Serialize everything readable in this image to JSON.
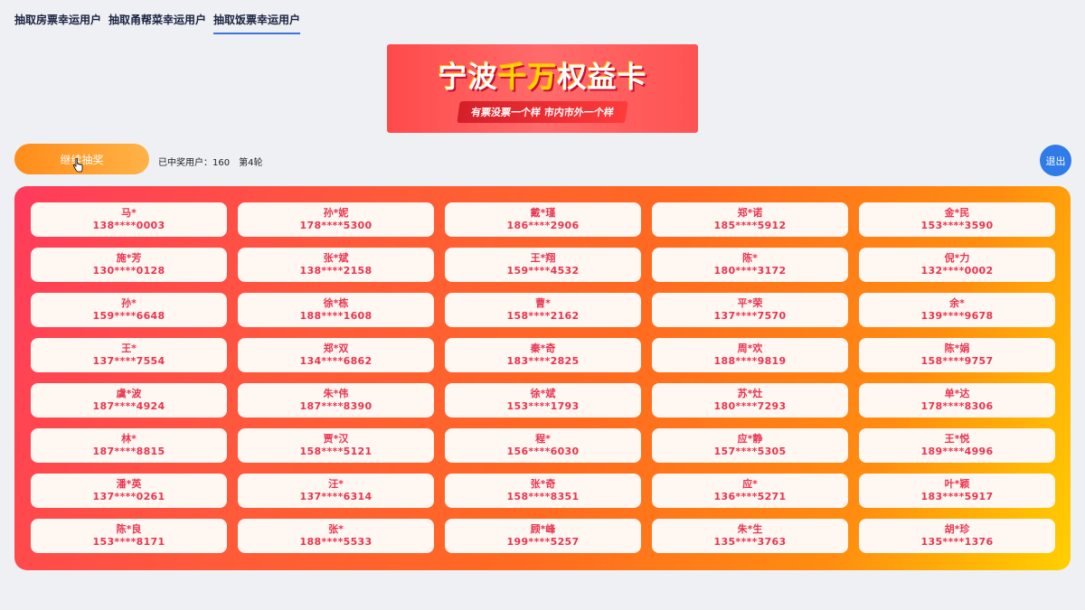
{
  "tabs": [
    {
      "label": "抽取房票幸运用户"
    },
    {
      "label": "抽取甬帮菜幸运用户"
    },
    {
      "label": "抽取饭票幸运用户"
    }
  ],
  "banner": {
    "title_prefix": "宁波",
    "title_highlight": "千万",
    "title_suffix": "权益卡",
    "subtitle": "有票没票一个样 市内市外一个样"
  },
  "toolbar": {
    "draw_label": "继续抽奖",
    "winners_text": "已中奖用户：160",
    "round_text": "第4轮",
    "exit_label": "退出"
  },
  "winners": [
    {
      "name": "马*",
      "phone": "138****0003"
    },
    {
      "name": "孙*妮",
      "phone": "178****5300"
    },
    {
      "name": "戴*瑾",
      "phone": "186****2906"
    },
    {
      "name": "郑*诺",
      "phone": "185****5912"
    },
    {
      "name": "金*民",
      "phone": "153****3590"
    },
    {
      "name": "施*芳",
      "phone": "130****0128"
    },
    {
      "name": "张*斌",
      "phone": "138****2158"
    },
    {
      "name": "王*翔",
      "phone": "159****4532"
    },
    {
      "name": "陈*",
      "phone": "180****3172"
    },
    {
      "name": "倪*力",
      "phone": "132****0002"
    },
    {
      "name": "孙*",
      "phone": "159****6648"
    },
    {
      "name": "徐*栋",
      "phone": "188****1608"
    },
    {
      "name": "曹*",
      "phone": "158****2162"
    },
    {
      "name": "平*荣",
      "phone": "137****7570"
    },
    {
      "name": "余*",
      "phone": "139****9678"
    },
    {
      "name": "王*",
      "phone": "137****7554"
    },
    {
      "name": "郑*双",
      "phone": "134****6862"
    },
    {
      "name": "秦*奇",
      "phone": "183****2825"
    },
    {
      "name": "周*欢",
      "phone": "188****9819"
    },
    {
      "name": "陈*娟",
      "phone": "158****9757"
    },
    {
      "name": "虞*波",
      "phone": "187****4924"
    },
    {
      "name": "朱*伟",
      "phone": "187****8390"
    },
    {
      "name": "徐*斌",
      "phone": "153****1793"
    },
    {
      "name": "苏*灶",
      "phone": "180****7293"
    },
    {
      "name": "单*达",
      "phone": "178****8306"
    },
    {
      "name": "林*",
      "phone": "187****8815"
    },
    {
      "name": "贾*汉",
      "phone": "158****5121"
    },
    {
      "name": "程*",
      "phone": "156****6030"
    },
    {
      "name": "应*静",
      "phone": "157****5305"
    },
    {
      "name": "王*悦",
      "phone": "189****4996"
    },
    {
      "name": "潘*英",
      "phone": "137****0261"
    },
    {
      "name": "汪*",
      "phone": "137****6314"
    },
    {
      "name": "张*奇",
      "phone": "158****8351"
    },
    {
      "name": "应*",
      "phone": "136****5271"
    },
    {
      "name": "叶*颖",
      "phone": "183****5917"
    },
    {
      "name": "陈*良",
      "phone": "153****8171"
    },
    {
      "name": "张*",
      "phone": "188****5533"
    },
    {
      "name": "顾*峰",
      "phone": "199****5257"
    },
    {
      "name": "朱*生",
      "phone": "135****3763"
    },
    {
      "name": "胡*珍",
      "phone": "135****1376"
    }
  ]
}
